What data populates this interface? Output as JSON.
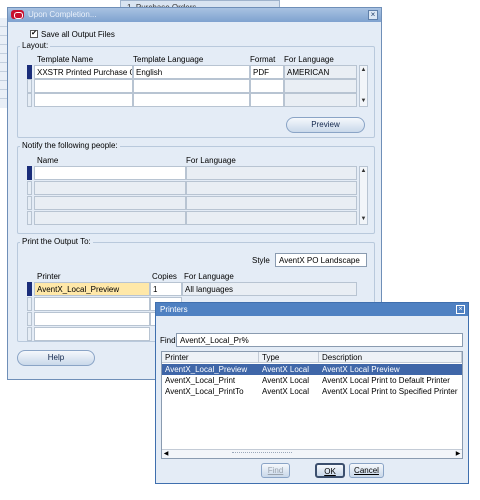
{
  "background": {
    "window_text": "1. Purchase Orders"
  },
  "main": {
    "title": "Upon Completion...",
    "save_all_label": "Save all Output Files",
    "save_all_checked": true,
    "layout": {
      "title": "Layout:",
      "columns": [
        "Template Name",
        "Template Language",
        "Format",
        "For Language"
      ],
      "rows": [
        [
          "XXSTR Printed Purchase O",
          "English",
          "PDF",
          "AMERICAN"
        ]
      ],
      "preview_label": "Preview"
    },
    "notify": {
      "title": "Notify the following people:",
      "columns": [
        "Name",
        "For Language"
      ]
    },
    "print": {
      "title": "Print the Output To:",
      "style_label": "Style",
      "style_value": "AventX PO Landscape",
      "columns": [
        "Printer",
        "Copies",
        "For Language"
      ],
      "row": [
        "AventX_Local_Preview",
        "1",
        "All languages"
      ]
    },
    "help_label": "Help"
  },
  "printers": {
    "title": "Printers",
    "find_label": "Find",
    "find_value": "AventX_Local_Pr%",
    "columns": [
      "Printer",
      "Type",
      "Description"
    ],
    "rows": [
      [
        "AventX_Local_Preview",
        "AventX Local",
        "AventX Local Preview"
      ],
      [
        "AventX_Local_Print",
        "AventX Local",
        "AventX Local Print to Default Printer"
      ],
      [
        "AventX_Local_PrintTo",
        "AventX Local",
        "AventX Local Print to Specified Printer"
      ]
    ],
    "selected_index": 0,
    "find_button": "Find",
    "ok_button": "OK",
    "cancel_button": "Cancel"
  }
}
